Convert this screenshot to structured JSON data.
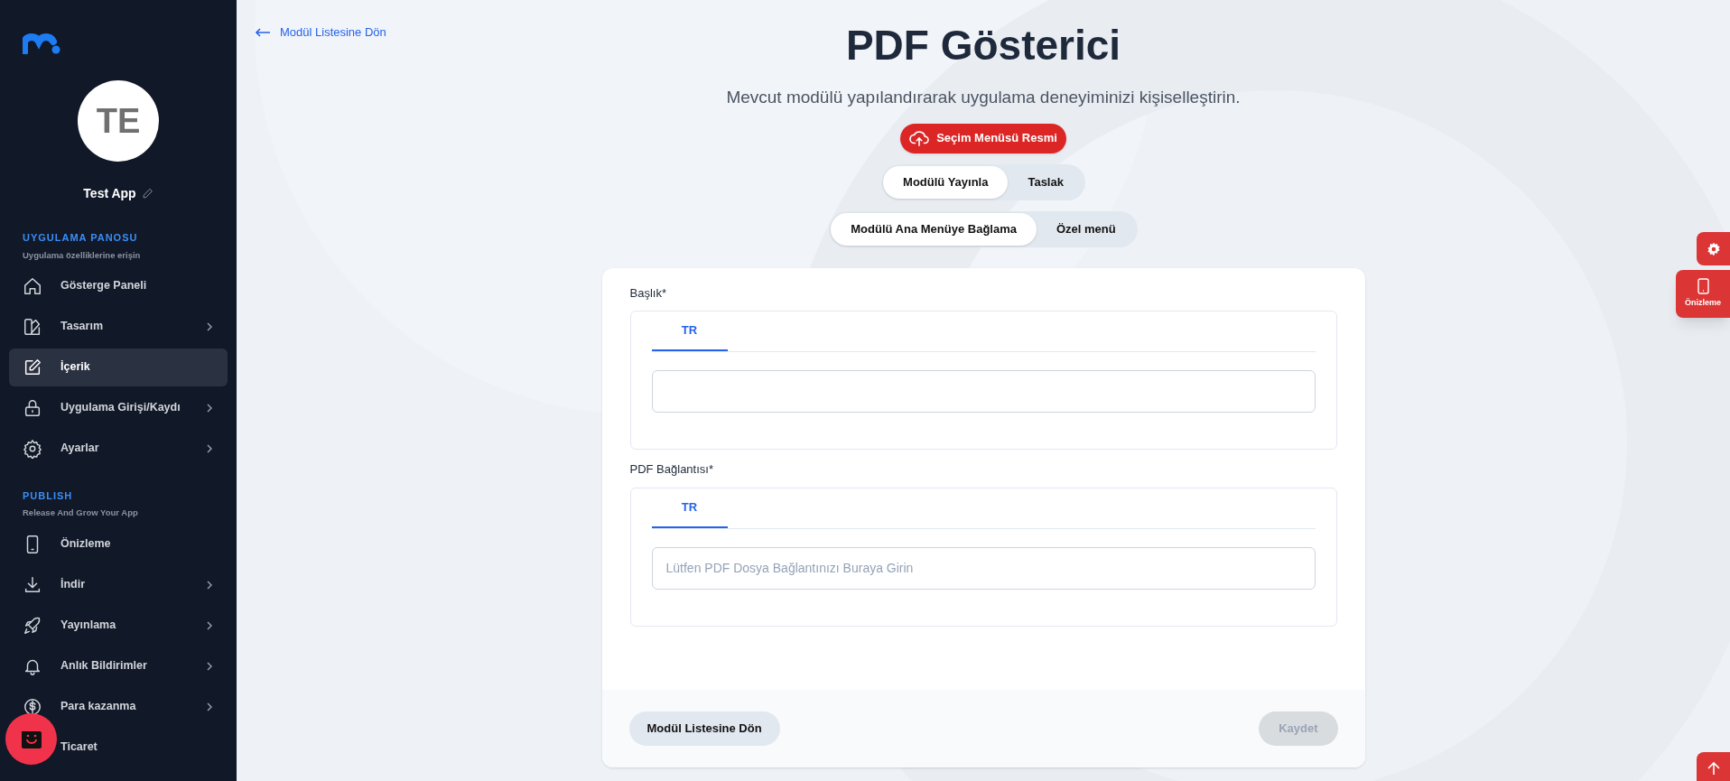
{
  "sidebar": {
    "avatar_initials": "TE",
    "app_name": "Test App",
    "sections": [
      {
        "title": "UYGULAMA PANOSU",
        "subtitle": "Uygulama özelliklerine erişin",
        "items": [
          {
            "label": "Gösterge Paneli",
            "selected": false,
            "has_submenu": false
          },
          {
            "label": "Tasarım",
            "selected": false,
            "has_submenu": true
          },
          {
            "label": "İçerik",
            "selected": true,
            "has_submenu": false
          },
          {
            "label": "Uygulama Girişi/Kaydı",
            "selected": false,
            "has_submenu": true
          },
          {
            "label": "Ayarlar",
            "selected": false,
            "has_submenu": true
          }
        ]
      },
      {
        "title": "PUBLISH",
        "subtitle": "Release And Grow Your App",
        "items": [
          {
            "label": "Önizleme",
            "selected": false,
            "has_submenu": false
          },
          {
            "label": "İndir",
            "selected": false,
            "has_submenu": true
          },
          {
            "label": "Yayınlama",
            "selected": false,
            "has_submenu": true
          },
          {
            "label": "Anlık Bildirimler",
            "selected": false,
            "has_submenu": true
          },
          {
            "label": "Para kazanma",
            "selected": false,
            "has_submenu": true
          },
          {
            "label": "Ticaret",
            "selected": false,
            "has_submenu": false
          }
        ]
      }
    ]
  },
  "back_link": "Modül Listesine Dön",
  "title": "PDF Gösterici",
  "subtitle": "Mevcut modülü yapılandırarak uygulama deneyiminizi kişiselleştirin.",
  "image_button": "Seçim Menüsü Resmi",
  "toggles": [
    [
      {
        "label": "Modülü Yayınla",
        "selected": true
      },
      {
        "label": "Taslak",
        "selected": false
      }
    ],
    [
      {
        "label": "Modülü Ana Menüye Bağlama",
        "selected": true
      },
      {
        "label": "Özel menü",
        "selected": false
      }
    ]
  ],
  "fields": [
    {
      "label": "Başlık*",
      "tabs": [
        {
          "label": "TR",
          "selected": true
        }
      ]
    },
    {
      "label": "PDF Bağlantısı*",
      "tabs": [
        {
          "label": "TR",
          "selected": true
        }
      ],
      "placeholder": "Lütfen PDF Dosya Bağlantınızı Buraya Girin"
    }
  ],
  "footer": {
    "back_button": "Modül Listesine Dön",
    "save_button": {
      "label": "Kaydet",
      "disabled": true
    }
  },
  "preview_button": "Önizleme"
}
